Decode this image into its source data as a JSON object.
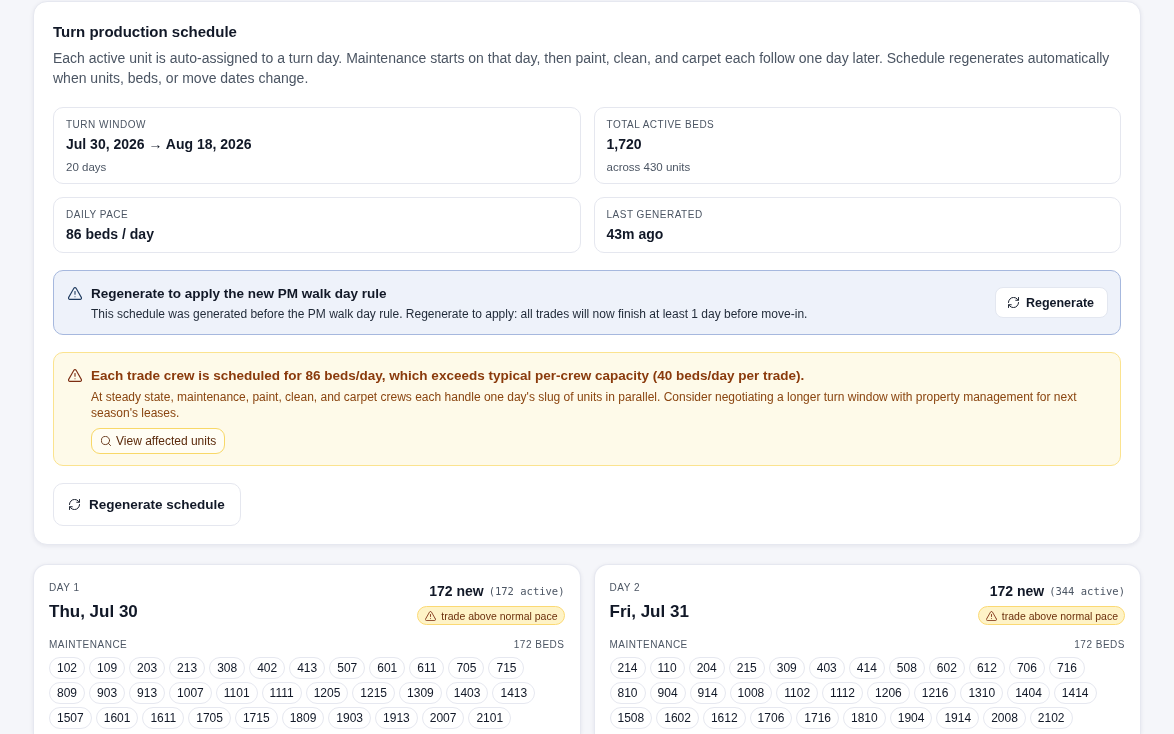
{
  "schedule": {
    "title": "Turn production schedule",
    "description": "Each active unit is auto-assigned to a turn day. Maintenance starts on that day, then paint, clean, and carpet each follow one day later. Schedule regenerates automatically when units, beds, or move dates change.",
    "stats": [
      {
        "label": "TURN WINDOW",
        "value": "Jul 30, 2026 → Aug 18, 2026",
        "note": "20 days"
      },
      {
        "label": "TOTAL ACTIVE BEDS",
        "value": "1,720",
        "note": "across 430 units"
      },
      {
        "label": "DAILY PACE",
        "value": "86 beds / day"
      },
      {
        "label": "LAST GENERATED",
        "value": "43m ago"
      }
    ],
    "alerts": [
      {
        "kind": "info",
        "title": "Regenerate to apply the new PM walk day rule",
        "body": "This schedule was generated before the PM walk day rule. Regenerate to apply: all trades will now finish at least 1 day before move-in.",
        "action": "Regenerate"
      },
      {
        "kind": "warning",
        "title": "Each trade crew is scheduled for 86 beds/day, which exceeds typical per-crew capacity (40 beds/day per trade).",
        "body": "At steady state, maintenance, paint, clean, and carpet crews each handle one day's slug of units in parallel. Consider negotiating a longer turn window with property management for next season's leases.",
        "action": "View affected units"
      }
    ],
    "regenerate_button": "Regenerate schedule"
  },
  "days": [
    {
      "day_label": "DAY 1",
      "date": "Thu, Jul 30",
      "new_count": "172 new",
      "active_count": "(172 active)",
      "badge": "trade above normal pace",
      "trades": [
        {
          "name": "MAINTENANCE",
          "beds": "172 BEDS",
          "units": [
            "102",
            "109",
            "203",
            "213",
            "308",
            "402",
            "413",
            "507",
            "601",
            "611",
            "705",
            "715",
            "809",
            "903",
            "913",
            "1007",
            "1101",
            "1111",
            "1205",
            "1215",
            "1309",
            "1403",
            "1413",
            "1507",
            "1601",
            "1611",
            "1705",
            "1715",
            "1809",
            "1903",
            "1913",
            "2007",
            "2101"
          ]
        }
      ]
    },
    {
      "day_label": "DAY 2",
      "date": "Fri, Jul 31",
      "new_count": "172 new",
      "active_count": "(344 active)",
      "badge": "trade above normal pace",
      "trades": [
        {
          "name": "MAINTENANCE",
          "beds": "172 BEDS",
          "units": [
            "214",
            "110",
            "204",
            "215",
            "309",
            "403",
            "414",
            "508",
            "602",
            "612",
            "706",
            "716",
            "810",
            "904",
            "914",
            "1008",
            "1102",
            "1112",
            "1206",
            "1216",
            "1310",
            "1404",
            "1414",
            "1508",
            "1602",
            "1612",
            "1706",
            "1716",
            "1810",
            "1904",
            "1914",
            "2008",
            "2102"
          ]
        }
      ]
    }
  ]
}
